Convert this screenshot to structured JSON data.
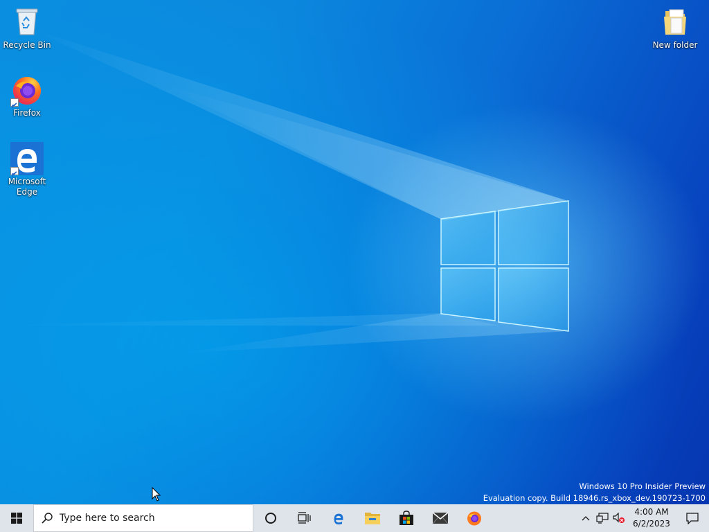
{
  "desktop": {
    "icons": [
      {
        "label": "Recycle Bin",
        "icon": "recycle-bin-icon"
      },
      {
        "label": "Firefox",
        "icon": "firefox-icon"
      },
      {
        "label": "Microsoft Edge",
        "icon": "edge-icon"
      },
      {
        "label": "New folder",
        "icon": "folder-icon"
      }
    ],
    "watermark": {
      "line1": "Windows 10 Pro Insider Preview",
      "line2": "Evaluation copy. Build 18946.rs_xbox_dev.190723-1700"
    }
  },
  "taskbar": {
    "start_icon": "windows-logo-icon",
    "search_placeholder": "Type here to search",
    "apps": [
      {
        "name": "Cortana",
        "icon": "cortana-circle-icon"
      },
      {
        "name": "Task View",
        "icon": "task-view-icon"
      },
      {
        "name": "Microsoft Edge",
        "icon": "edge-icon"
      },
      {
        "name": "File Explorer",
        "icon": "folder-icon"
      },
      {
        "name": "Microsoft Store",
        "icon": "store-bag-icon"
      },
      {
        "name": "Mail",
        "icon": "mail-icon"
      },
      {
        "name": "Firefox",
        "icon": "firefox-icon"
      }
    ],
    "tray": {
      "icons": [
        "chevron-up-icon",
        "network-icon",
        "volume-muted-icon"
      ],
      "time": "4:00 AM",
      "date": "6/2/2023",
      "notification_icon": "action-center-icon"
    }
  },
  "colors": {
    "taskbar_bg": "#dfe3ea",
    "desktop_blue": "#0a8fe0",
    "edge_blue": "#1a73d4"
  }
}
